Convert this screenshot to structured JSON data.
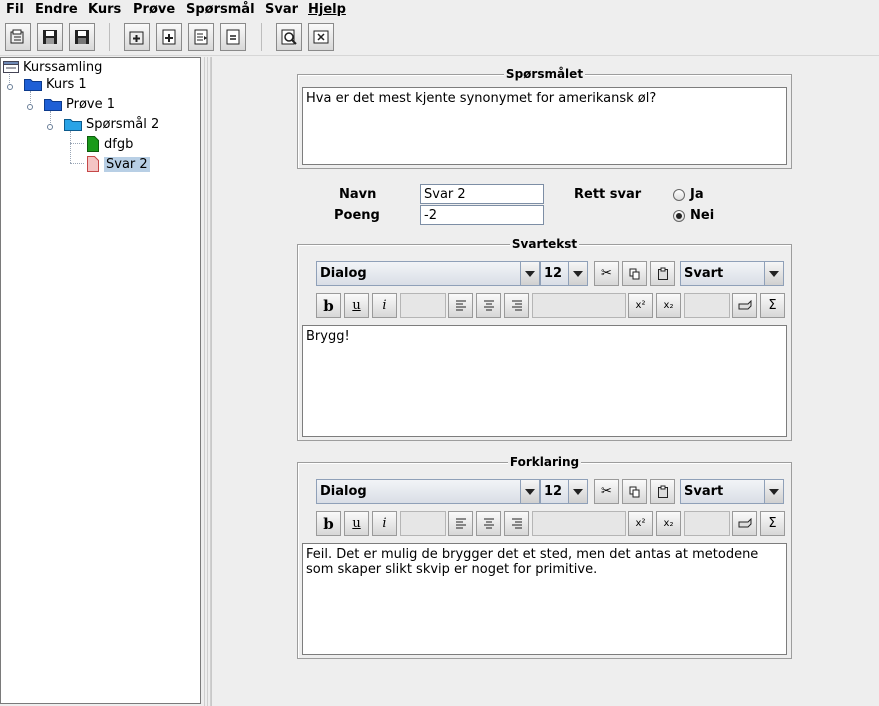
{
  "menubar": {
    "items": [
      "Fil",
      "Endre",
      "Kurs",
      "Prøve",
      "Spørsmål",
      "Svar",
      "Hjelp"
    ]
  },
  "toolbar": {
    "buttons": [
      "open-icon",
      "save-icon",
      "save-as-icon",
      "add-folder-icon",
      "add-icon",
      "edit-doc-icon",
      "equals-icon",
      "preview-icon",
      "close-doc-icon"
    ]
  },
  "tree": {
    "root": "Kurssamling",
    "course": "Kurs 1",
    "test": "Prøve 1",
    "question": "Spørsmål 2",
    "answer1": "dfgb",
    "answer2": "Svar 2"
  },
  "question_group": {
    "title": "Spørsmålet",
    "text": "Hva er det mest kjente synonymet for amerikansk øl?"
  },
  "form": {
    "name_label": "Navn",
    "name_value": "Svar 2",
    "points_label": "Poeng",
    "points_value": "-2",
    "correct_label": "Rett svar",
    "yes_label": "Ja",
    "no_label": "Nei",
    "selected": "Nei"
  },
  "answer_group": {
    "title": "Svartekst",
    "font": "Dialog",
    "size": "12",
    "color": "Svart",
    "text": "Brygg!"
  },
  "explanation_group": {
    "title": "Forklaring",
    "font": "Dialog",
    "size": "12",
    "color": "Svart",
    "text": "Feil. Det er mulig de brygger det et sted, men det antas at metodene som skaper slikt skvip er noget for primitive."
  },
  "editor_buttons": {
    "bold": "b",
    "underline": "u",
    "italic": "i",
    "superscript": "x²",
    "subscript": "x₂",
    "sigma": "Σ"
  },
  "colors": {
    "background": "#eeeeee",
    "selection": "#b8cfe5",
    "folder": "#1e5fd6",
    "green_doc": "#1a9a1a",
    "red_doc": "#e37a7a"
  }
}
